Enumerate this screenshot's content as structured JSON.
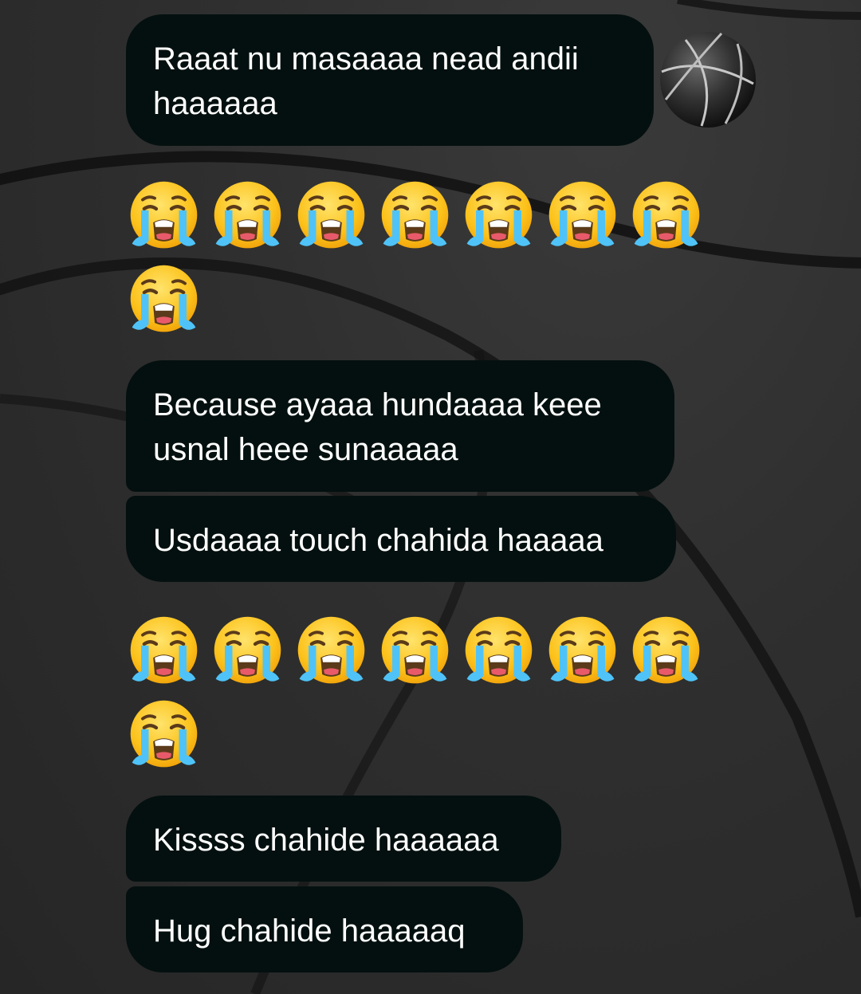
{
  "messages": [
    {
      "text": "Raaat nu masaaaa nead andii\nhaaaaaa"
    },
    {
      "text": "Because ayaaa hundaaaa keee\nusnal heee sunaaaaa"
    },
    {
      "text": "Usdaaaa touch chahida haaaaa"
    },
    {
      "text": "Kissss chahide haaaaaa"
    },
    {
      "text": "Hug chahide haaaaaq"
    }
  ],
  "emoji_groups": [
    {
      "icon": "loudly-crying-face",
      "count": 8
    },
    {
      "icon": "loudly-crying-face",
      "count": 8
    }
  ],
  "colors": {
    "bubble": "#04100f",
    "text": "#ffffff",
    "background": "#2e2e2e"
  }
}
